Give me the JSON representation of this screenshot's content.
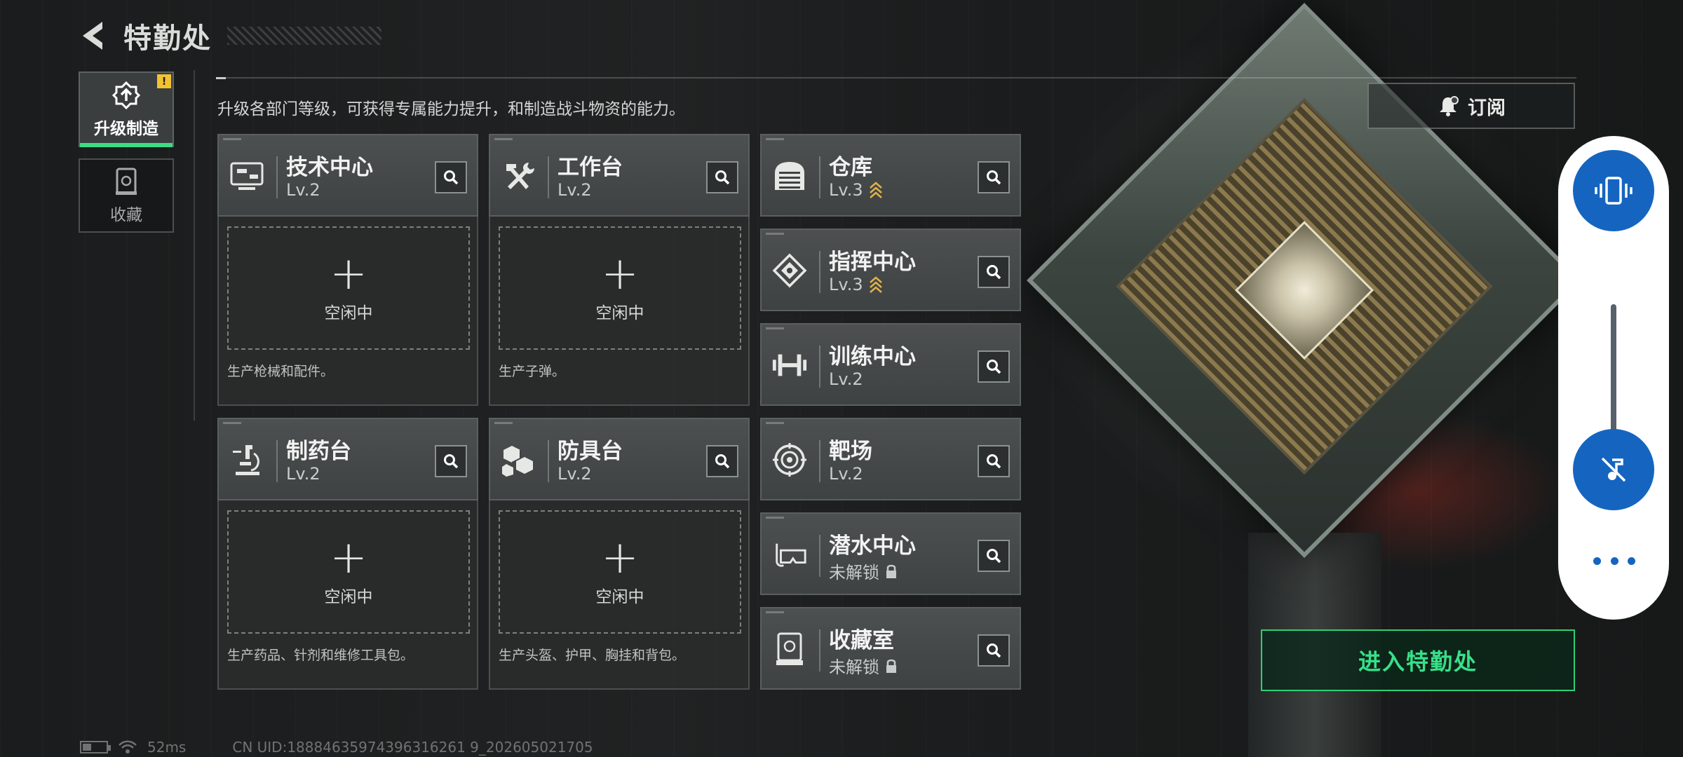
{
  "header": {
    "title": "特勤处",
    "back_icon": "back-arrow-icon"
  },
  "sidebar": {
    "items": [
      {
        "label": "升级制造",
        "icon": "upgrade-gear-icon",
        "active": true,
        "badge": "!"
      },
      {
        "label": "收藏",
        "icon": "collection-jar-icon",
        "active": false
      }
    ]
  },
  "description": "升级各部门等级，可获得专属能力提升，和制造战斗物资的能力。",
  "subscribe": {
    "label": "订阅",
    "icon": "bell-subscribe-icon"
  },
  "departments": {
    "tech_center": {
      "name": "技术中心",
      "level": "Lv.2",
      "icon": "tech-console-icon",
      "idle": "空闲中",
      "desc": "生产枪械和配件。"
    },
    "workbench": {
      "name": "工作台",
      "level": "Lv.2",
      "icon": "hammer-wrench-icon",
      "idle": "空闲中",
      "desc": "生产子弹。"
    },
    "pharmacy": {
      "name": "制药台",
      "level": "Lv.2",
      "icon": "microscope-icon",
      "idle": "空闲中",
      "desc": "生产药品、针剂和维修工具包。"
    },
    "armor_bench": {
      "name": "防具台",
      "level": "Lv.2",
      "icon": "armor-cubes-icon",
      "idle": "空闲中",
      "desc": "生产头盔、护甲、胸挂和背包。"
    },
    "warehouse": {
      "name": "仓库",
      "level": "Lv.3",
      "icon": "warehouse-shutter-icon",
      "upgradable": true
    },
    "command_center": {
      "name": "指挥中心",
      "level": "Lv.3",
      "icon": "command-chip-icon",
      "upgradable": true
    },
    "training_center": {
      "name": "训练中心",
      "level": "Lv.2",
      "icon": "dumbbell-icon"
    },
    "shooting_range": {
      "name": "靶场",
      "level": "Lv.2",
      "icon": "target-icon"
    },
    "diving_center": {
      "name": "潜水中心",
      "level": "未解锁",
      "icon": "diving-mask-icon",
      "locked": true
    },
    "collection_room": {
      "name": "收藏室",
      "level": "未解锁",
      "icon": "display-case-icon",
      "locked": true
    }
  },
  "enter_button": {
    "label": "进入特勤处"
  },
  "status_bar": {
    "ping": "52ms",
    "uid": "CN UID:18884635974396316261 9_202605021705"
  },
  "colors": {
    "accent_green": "#37e089",
    "upgrade_gold": "#e0b24a",
    "pill_blue": "#1565c0"
  }
}
